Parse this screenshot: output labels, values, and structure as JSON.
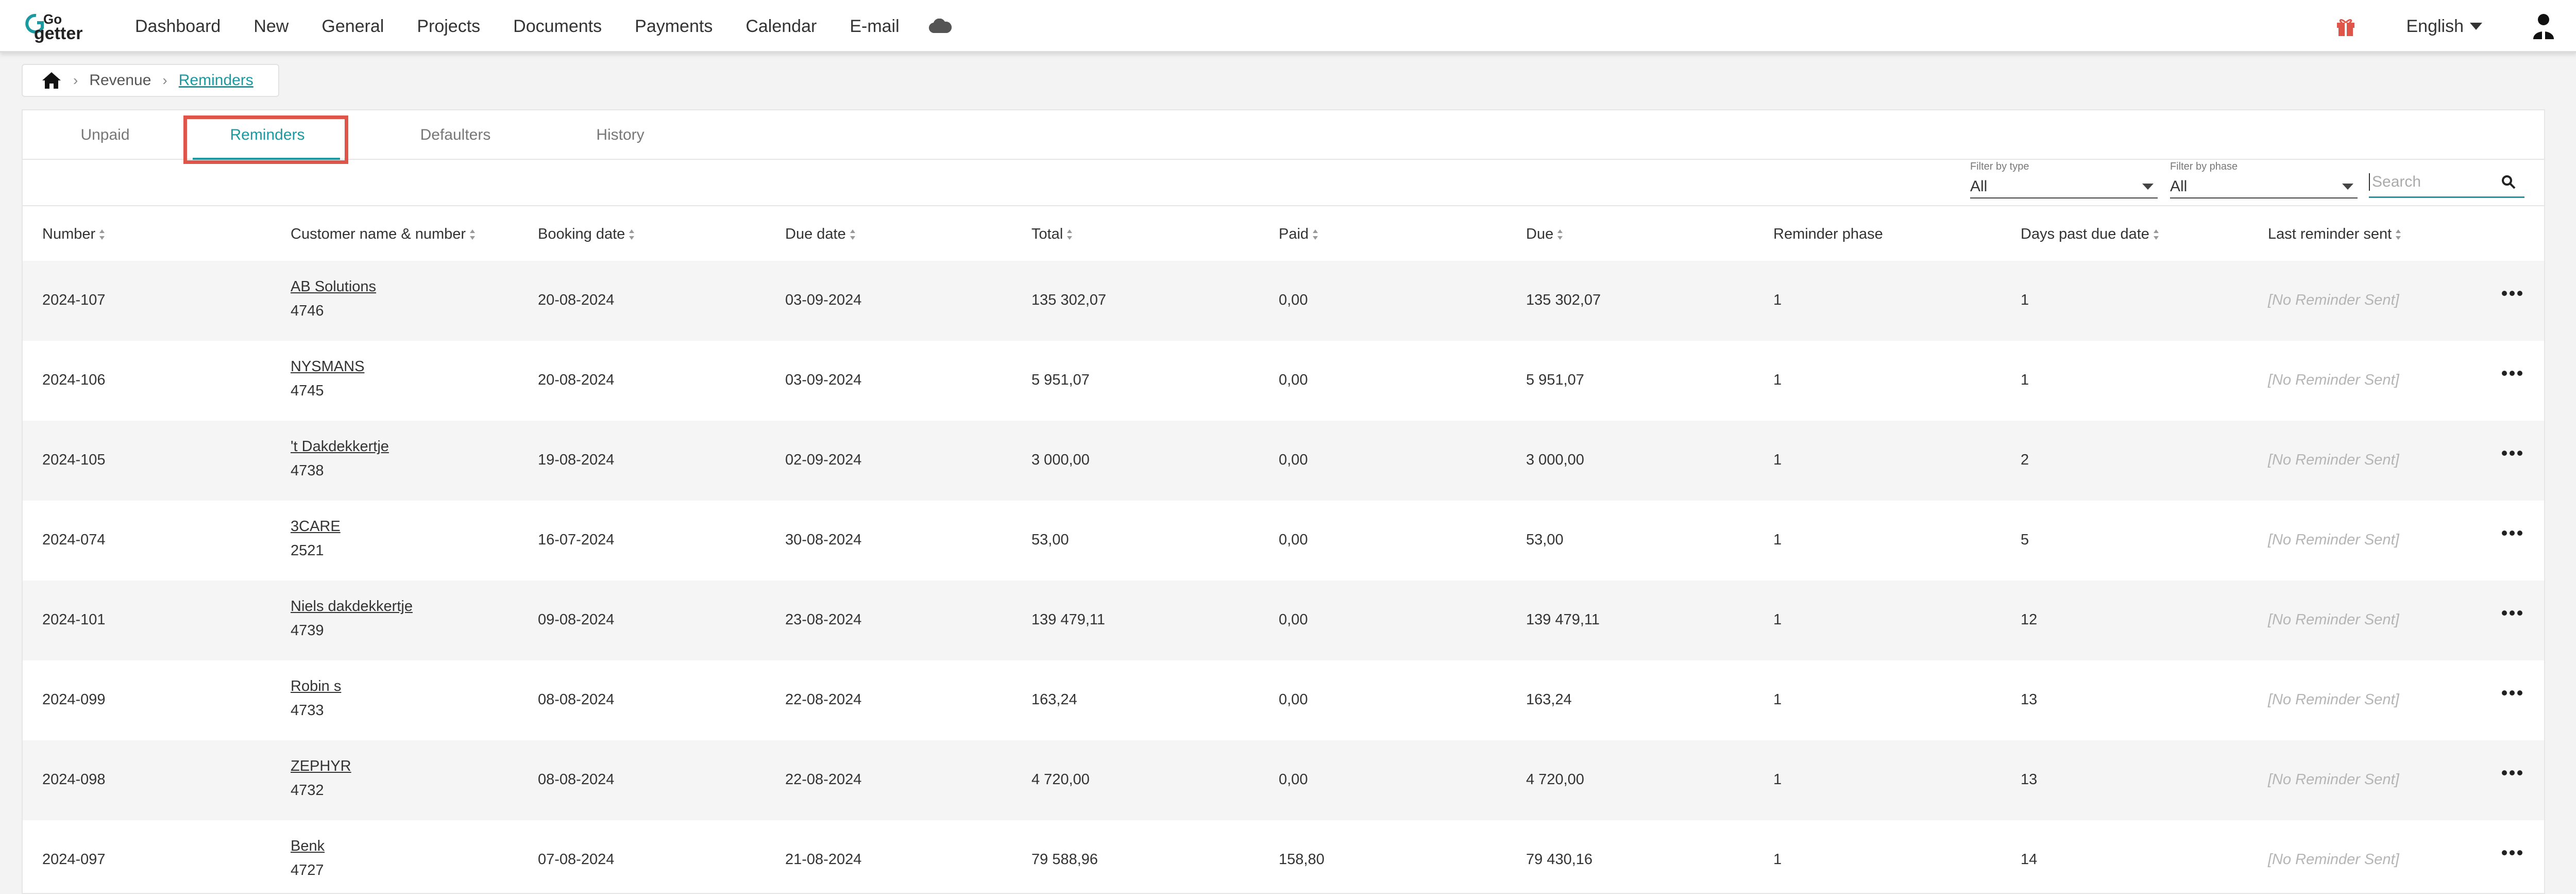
{
  "app": {
    "logo_text_top": "Go",
    "logo_text_bottom": "getter",
    "brand_color": "#1a9aa0",
    "highlight_color": "#e0554a"
  },
  "nav": {
    "items": [
      "Dashboard",
      "New",
      "General",
      "Projects",
      "Documents",
      "Payments",
      "Calendar",
      "E-mail"
    ],
    "cloud_icon": "cloud-icon",
    "gift_icon": "gift-icon",
    "language": "English",
    "user_icon": "user-icon"
  },
  "breadcrumb": {
    "home_icon": "home-icon",
    "items": [
      "Revenue",
      "Reminders"
    ]
  },
  "tabs": [
    "Unpaid",
    "Reminders",
    "Defaulters",
    "History"
  ],
  "active_tab": "Reminders",
  "filters": {
    "type": {
      "label": "Filter by type",
      "value": "All"
    },
    "phase": {
      "label": "Filter by phase",
      "value": "All"
    },
    "search": {
      "placeholder": "Search"
    }
  },
  "table": {
    "columns": [
      "Number",
      "Customer name & number",
      "Booking date",
      "Due date",
      "Total",
      "Paid",
      "Due",
      "Reminder phase",
      "Days past due date",
      "Last reminder sent"
    ],
    "rows": [
      {
        "number": "2024-107",
        "customer": "AB Solutions",
        "customer_no": "4746",
        "booking": "20-08-2024",
        "due_date": "03-09-2024",
        "total": "135 302,07",
        "paid": "0,00",
        "due": "135 302,07",
        "phase": "1",
        "days": "1",
        "last": "[No Reminder Sent]"
      },
      {
        "number": "2024-106",
        "customer": "NYSMANS",
        "customer_no": "4745",
        "booking": "20-08-2024",
        "due_date": "03-09-2024",
        "total": "5 951,07",
        "paid": "0,00",
        "due": "5 951,07",
        "phase": "1",
        "days": "1",
        "last": "[No Reminder Sent]"
      },
      {
        "number": "2024-105",
        "customer": "'t Dakdekkertje",
        "customer_no": "4738",
        "booking": "19-08-2024",
        "due_date": "02-09-2024",
        "total": "3 000,00",
        "paid": "0,00",
        "due": "3 000,00",
        "phase": "1",
        "days": "2",
        "last": "[No Reminder Sent]"
      },
      {
        "number": "2024-074",
        "customer": "3CARE",
        "customer_no": "2521",
        "booking": "16-07-2024",
        "due_date": "30-08-2024",
        "total": "53,00",
        "paid": "0,00",
        "due": "53,00",
        "phase": "1",
        "days": "5",
        "last": "[No Reminder Sent]"
      },
      {
        "number": "2024-101",
        "customer": "Niels dakdekkertje",
        "customer_no": "4739",
        "booking": "09-08-2024",
        "due_date": "23-08-2024",
        "total": "139 479,11",
        "paid": "0,00",
        "due": "139 479,11",
        "phase": "1",
        "days": "12",
        "last": "[No Reminder Sent]"
      },
      {
        "number": "2024-099",
        "customer": "Robin s",
        "customer_no": "4733",
        "booking": "08-08-2024",
        "due_date": "22-08-2024",
        "total": "163,24",
        "paid": "0,00",
        "due": "163,24",
        "phase": "1",
        "days": "13",
        "last": "[No Reminder Sent]"
      },
      {
        "number": "2024-098",
        "customer": "ZEPHYR",
        "customer_no": "4732",
        "booking": "08-08-2024",
        "due_date": "22-08-2024",
        "total": "4 720,00",
        "paid": "0,00",
        "due": "4 720,00",
        "phase": "1",
        "days": "13",
        "last": "[No Reminder Sent]"
      },
      {
        "number": "2024-097",
        "customer": "Benk",
        "customer_no": "4727",
        "booking": "07-08-2024",
        "due_date": "21-08-2024",
        "total": "79 588,96",
        "paid": "158,80",
        "due": "79 430,16",
        "phase": "1",
        "days": "14",
        "last": "[No Reminder Sent]"
      }
    ],
    "row_action_icon": "more-horizontal-icon"
  }
}
